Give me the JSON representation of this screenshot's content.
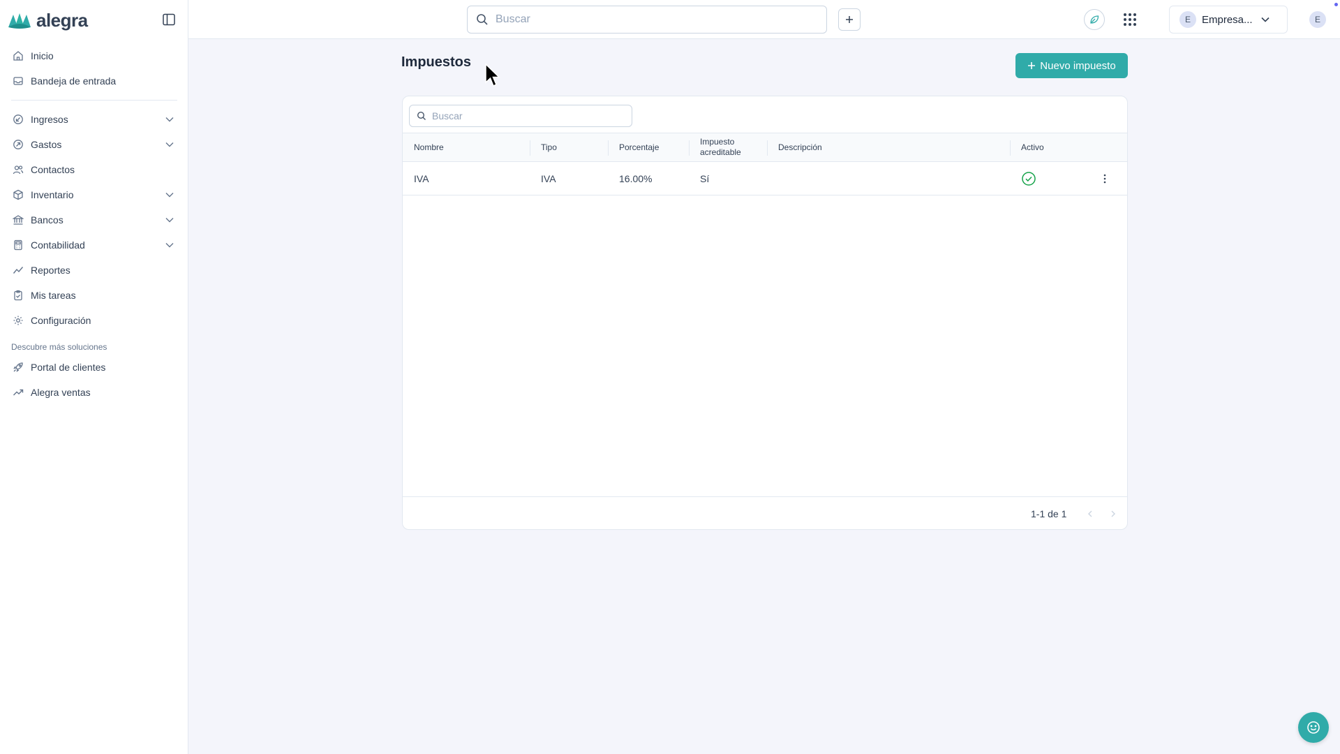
{
  "app": {
    "logo_text": "alegra"
  },
  "sidebar": {
    "items_top": [
      {
        "label": "Inicio",
        "icon": "home-icon"
      },
      {
        "label": "Bandeja de entrada",
        "icon": "inbox-icon"
      }
    ],
    "items_main": [
      {
        "label": "Ingresos",
        "icon": "income-icon",
        "expandable": true
      },
      {
        "label": "Gastos",
        "icon": "expense-icon",
        "expandable": true
      },
      {
        "label": "Contactos",
        "icon": "contacts-icon",
        "expandable": false
      },
      {
        "label": "Inventario",
        "icon": "box-icon",
        "expandable": true
      },
      {
        "label": "Bancos",
        "icon": "bank-icon",
        "expandable": true
      },
      {
        "label": "Contabilidad",
        "icon": "calculator-icon",
        "expandable": true
      },
      {
        "label": "Reportes",
        "icon": "chart-line-icon",
        "expandable": false
      },
      {
        "label": "Mis tareas",
        "icon": "clipboard-icon",
        "expandable": false
      },
      {
        "label": "Configuración",
        "icon": "gear-icon",
        "expandable": false
      }
    ],
    "section_label": "Descubre más soluciones",
    "items_more": [
      {
        "label": "Portal de clientes",
        "icon": "rocket-icon"
      },
      {
        "label": "Alegra ventas",
        "icon": "trend-icon"
      }
    ]
  },
  "topbar": {
    "search_placeholder": "Buscar",
    "company_initial": "E",
    "company_name": "Empresa...",
    "user_initial": "E"
  },
  "page": {
    "title": "Impuestos",
    "new_button_label": "Nuevo impuesto"
  },
  "table": {
    "search_placeholder": "Buscar",
    "columns": [
      "Nombre",
      "Tipo",
      "Porcentaje",
      "Impuesto acreditable",
      "Descripción",
      "Activo"
    ],
    "rows": [
      {
        "nombre": "IVA",
        "tipo": "IVA",
        "porcentaje": "16.00%",
        "acreditable": "Sí",
        "descripcion": "",
        "activo": true
      }
    ],
    "pagination": "1-1 de 1"
  },
  "colors": {
    "accent": "#30aba9",
    "active_check": "#16a34a"
  }
}
